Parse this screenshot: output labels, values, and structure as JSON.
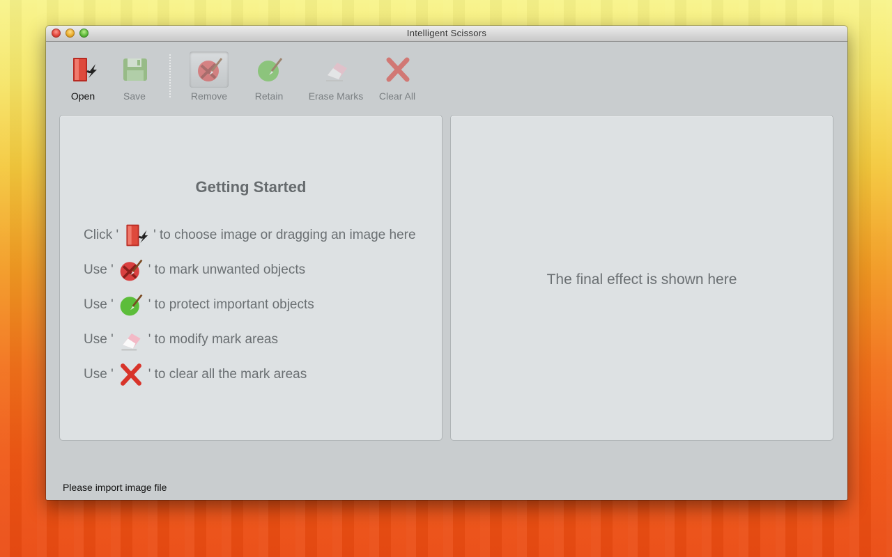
{
  "window": {
    "title": "Intelligent Scissors"
  },
  "toolbar": {
    "open": "Open",
    "save": "Save",
    "remove": "Remove",
    "retain": "Retain",
    "erase_marks": "Erase Marks",
    "clear_all": "Clear All"
  },
  "left_panel": {
    "title": "Getting Started",
    "rows": [
      {
        "pre": "Click '",
        "post": "' to choose image or dragging an image here",
        "icon": "open-icon"
      },
      {
        "pre": "Use '",
        "post": "' to mark unwanted objects",
        "icon": "remove-brush-icon"
      },
      {
        "pre": "Use '",
        "post": "' to protect important objects",
        "icon": "retain-brush-icon"
      },
      {
        "pre": "Use '",
        "post": "' to modify mark areas",
        "icon": "eraser-icon"
      },
      {
        "pre": "Use '",
        "post": "' to clear all the mark areas",
        "icon": "clear-x-icon"
      }
    ]
  },
  "right_panel": {
    "message": "The final effect is shown here"
  },
  "status": {
    "text": "Please import image file"
  },
  "colors": {
    "open_red": "#d63a2f",
    "remove_red": "#d94040",
    "retain_green": "#5cbd3a",
    "clear_red": "#d8342a",
    "panel_bg": "#dde1e3",
    "window_bg": "#c9cdcf"
  }
}
